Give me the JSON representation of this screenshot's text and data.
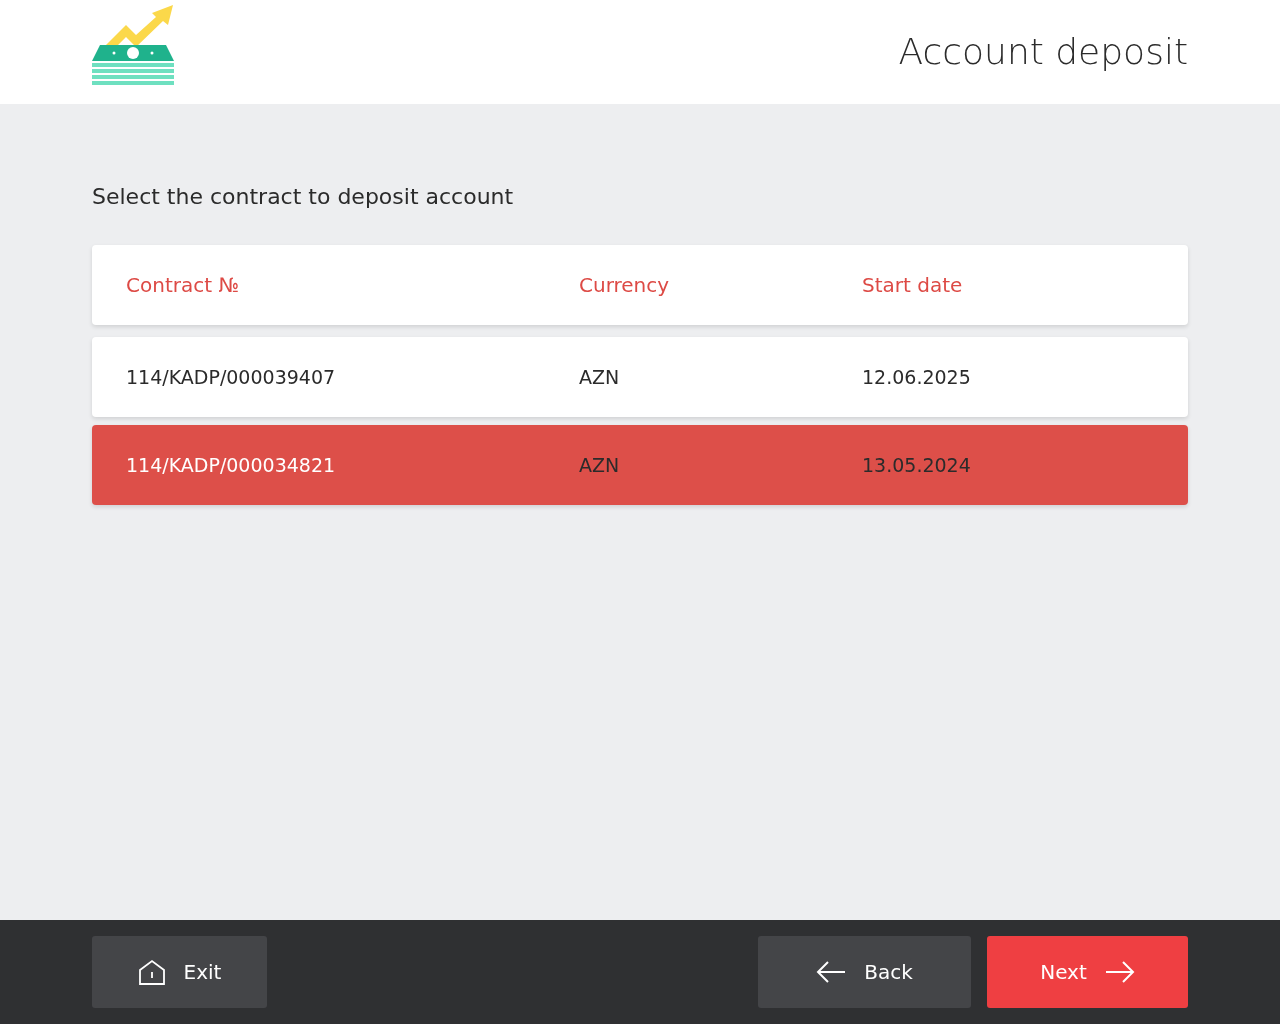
{
  "header": {
    "title": "Account deposit"
  },
  "instruction": "Select the contract to deposit account",
  "table": {
    "columns": [
      "Contract №",
      "Currency",
      "Start date"
    ],
    "rows": [
      {
        "cells": [
          "114/KADP/000039407",
          "AZN",
          "12.06.2025"
        ],
        "selected": false
      },
      {
        "cells": [
          "114/KADP/000034821",
          "AZN",
          "13.05.2024"
        ],
        "selected": true
      }
    ]
  },
  "footer": {
    "exit": "Exit",
    "back": "Back",
    "next": "Next"
  }
}
